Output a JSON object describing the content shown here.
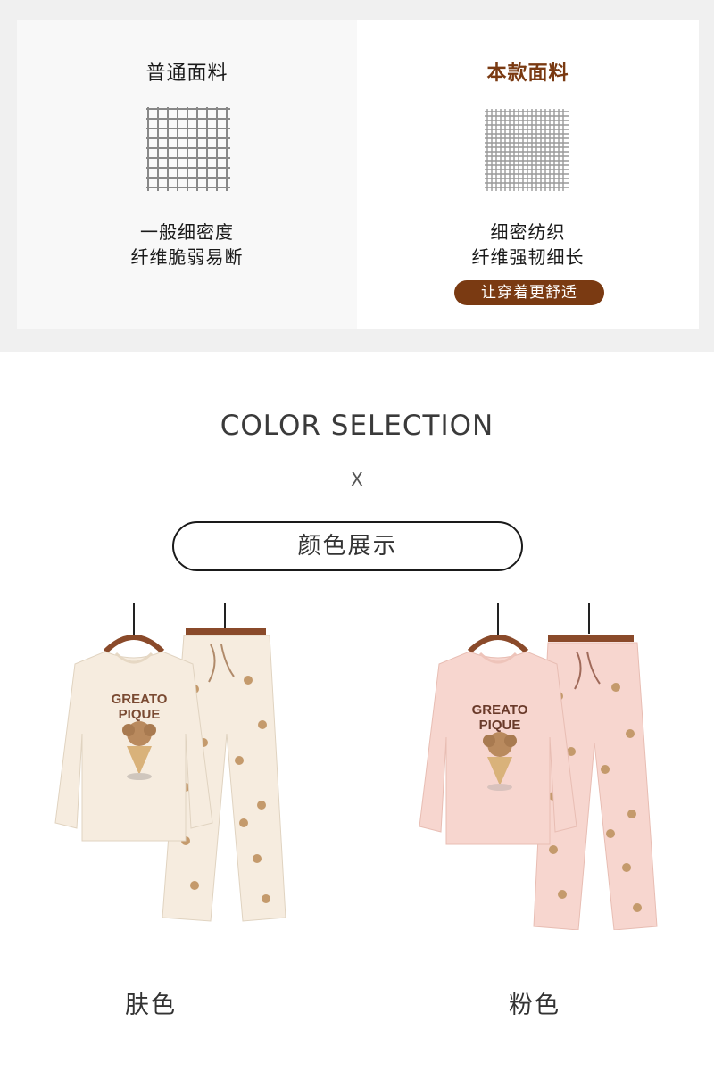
{
  "compare": {
    "left": {
      "title": "普通面料",
      "line1": "一般细密度",
      "line2": "纤维脆弱易断"
    },
    "right": {
      "title": "本款面料",
      "line1": "细密纺织",
      "line2": "纤维强韧细长",
      "badge": "让穿着更舒适"
    }
  },
  "section": {
    "heading": "COLOR SELECTION",
    "separator": "X",
    "frame_title": "颜色展示"
  },
  "products": [
    {
      "label": "肤色",
      "print_line1": "GREATO",
      "print_line2": "PIQUE",
      "fabric_color": "#f6ecdf"
    },
    {
      "label": "粉色",
      "print_line1": "GREATO",
      "print_line2": "PIQUE",
      "fabric_color": "#f7d6cf"
    }
  ],
  "colors": {
    "accent": "#7a3a12",
    "hanger": "#8a4a2a"
  }
}
